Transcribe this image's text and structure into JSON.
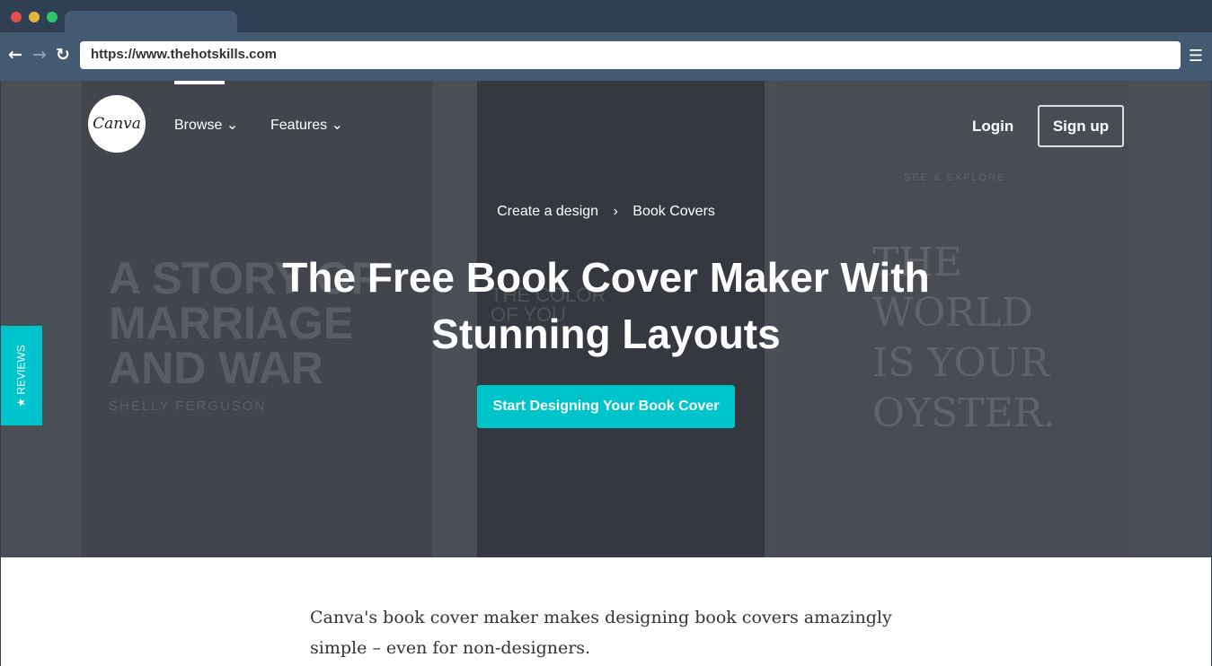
{
  "browser": {
    "url": "https://www.thehotskills.com",
    "colors": {
      "close": "#e0504f",
      "minimize": "#e3b53b",
      "maximize": "#2fc76c"
    },
    "icons": [
      "back-icon",
      "forward-icon",
      "reload-icon",
      "menu-icon"
    ]
  },
  "header": {
    "logo": "Canva",
    "nav": [
      {
        "label": "Browse"
      },
      {
        "label": "Features"
      }
    ],
    "login": "Login",
    "signup": "Sign up"
  },
  "hero": {
    "breadcrumb": [
      "Create a design",
      "Book Covers"
    ],
    "title": "The Free Book Cover Maker With Stunning Layouts",
    "cta": "Start Designing Your Book Cover",
    "background_covers": {
      "left": "A STORY OF\nMARRIAGE\nAND WAR",
      "left_author": "SHELLY FERGUSON",
      "center": "THE COLOR\nOF YOU",
      "right_top": "SEE & EXPLORE",
      "right": "THE\nWORLD\nIS YOUR\nOYSTER."
    }
  },
  "reviews_tab": "★ REVIEWS",
  "content": {
    "lead": "Canva's book cover maker makes designing book covers amazingly simple – even for non-designers."
  },
  "accent": "#00c4cc"
}
